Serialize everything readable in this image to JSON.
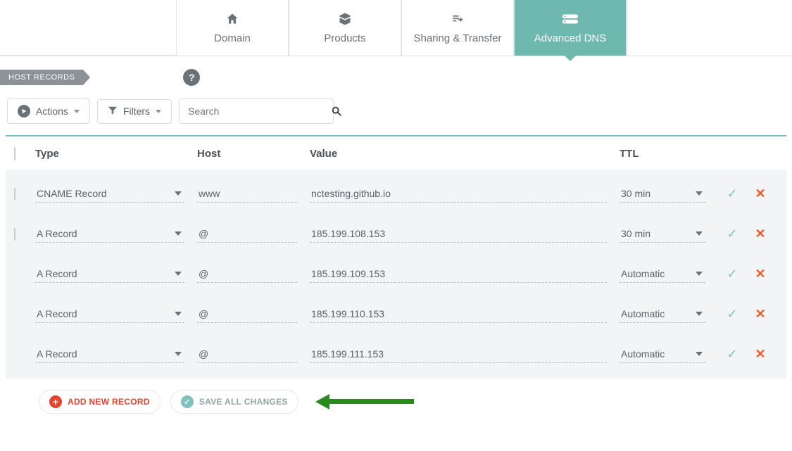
{
  "tabs": {
    "domain": "Domain",
    "products": "Products",
    "sharing": "Sharing & Transfer",
    "advanced_dns": "Advanced DNS"
  },
  "section": {
    "host_records": "HOST RECORDS"
  },
  "toolbar": {
    "actions": "Actions",
    "filters": "Filters",
    "search_placeholder": "Search"
  },
  "table": {
    "headers": {
      "type": "Type",
      "host": "Host",
      "value": "Value",
      "ttl": "TTL"
    },
    "rows": [
      {
        "type": "CNAME Record",
        "host": "www",
        "value": "nctesting.github.io",
        "ttl": "30 min",
        "has_checkbox": true
      },
      {
        "type": "A Record",
        "host": "@",
        "value": "185.199.108.153",
        "ttl": "30 min",
        "has_checkbox": true
      },
      {
        "type": "A Record",
        "host": "@",
        "value": "185.199.109.153",
        "ttl": "Automatic",
        "has_checkbox": false
      },
      {
        "type": "A Record",
        "host": "@",
        "value": "185.199.110.153",
        "ttl": "Automatic",
        "has_checkbox": false
      },
      {
        "type": "A Record",
        "host": "@",
        "value": "185.199.111.153",
        "ttl": "Automatic",
        "has_checkbox": false
      }
    ]
  },
  "footer": {
    "add_new_record": "ADD NEW RECORD",
    "save_all_changes": "SAVE ALL CHANGES"
  },
  "colors": {
    "accent": "#6fb8af",
    "danger": "#e8432e",
    "annotation_arrow": "#2b8a1f"
  }
}
